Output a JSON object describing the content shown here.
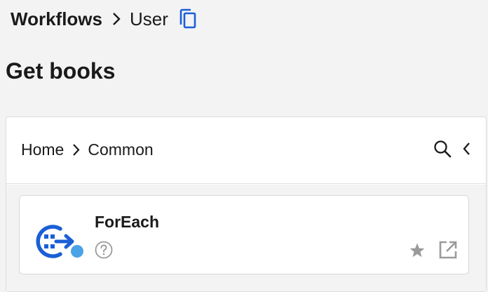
{
  "breadcrumb": {
    "root": "Workflows",
    "current": "User"
  },
  "page": {
    "title": "Get books"
  },
  "panel": {
    "breadcrumb": [
      "Home",
      "Common"
    ]
  },
  "card": {
    "name": "ForEach",
    "status": "active",
    "icons": [
      "foreach-icon",
      "help-icon",
      "star-icon",
      "open-external-icon"
    ]
  },
  "colors": {
    "accent": "#1a5fd6",
    "status_dot": "#4aa3e6",
    "background": "#f3f3f3",
    "muted_icon": "#9a9a9a"
  }
}
